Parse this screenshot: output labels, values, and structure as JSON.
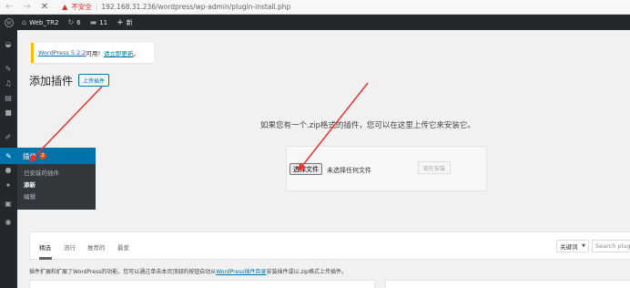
{
  "browser": {
    "back_icon": "arrow-left-icon",
    "forward_icon": "arrow-right-icon",
    "close_icon": "close-icon",
    "insecure_label": "不安全",
    "url": "192.168.31.236/wordpress/wp-admin/plugin-install.php"
  },
  "admin_bar": {
    "site_name": "Web_TR2",
    "updates_count": "6",
    "comments_count": "11",
    "new_label": "新"
  },
  "menu": {
    "plugins_label": "插件",
    "plugins_badge": "2",
    "submenu": [
      "已安装的插件",
      "添新",
      "编辑"
    ]
  },
  "notice": {
    "version_link": "WordPress 5.2.2",
    "middle_text": "可用！",
    "update_link": "请立即更新",
    "end_text": "。"
  },
  "page": {
    "title": "添加插件",
    "upload_button": "上传插件",
    "help_text": "如果您有一个.zip格式的插件，您可以在这里上传它来安装它。"
  },
  "upload": {
    "choose_file": "选择文件",
    "no_file": "未选择任何文件",
    "install_now": "现在安装"
  },
  "filters": {
    "tabs": [
      "精选",
      "流行",
      "推荐的",
      "最爱"
    ],
    "keyword_select": "关键词",
    "search_placeholder": "Search plugins..."
  },
  "description": {
    "before": "插件扩展和扩展了WordPress的功能。您可以通过单击本页顶部的按钮自动从",
    "link": "WordPress插件目录",
    "after": "安装插件或以.zip格式上传插件。"
  },
  "colors": {
    "admin_dark": "#23282d",
    "accent_blue": "#0073aa",
    "notice_yellow": "#ffb900",
    "annotation_red": "#e8332a"
  }
}
